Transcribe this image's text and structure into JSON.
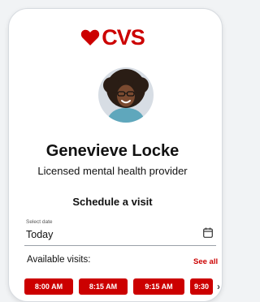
{
  "brand": {
    "name": "CVS",
    "icon": "heart-icon",
    "color": "#cc0000"
  },
  "provider": {
    "name": "Genevieve Locke",
    "title": "Licensed mental health provider"
  },
  "schedule": {
    "heading": "Schedule a visit",
    "date_label": "Select date",
    "date_value": "Today",
    "calendar_icon": "calendar-icon",
    "available_label": "Available visits:",
    "see_all": "See all",
    "slots": [
      "8:00 AM",
      "8:15 AM",
      "9:15 AM",
      "9:30"
    ],
    "next_icon": "chevron-right-icon"
  }
}
